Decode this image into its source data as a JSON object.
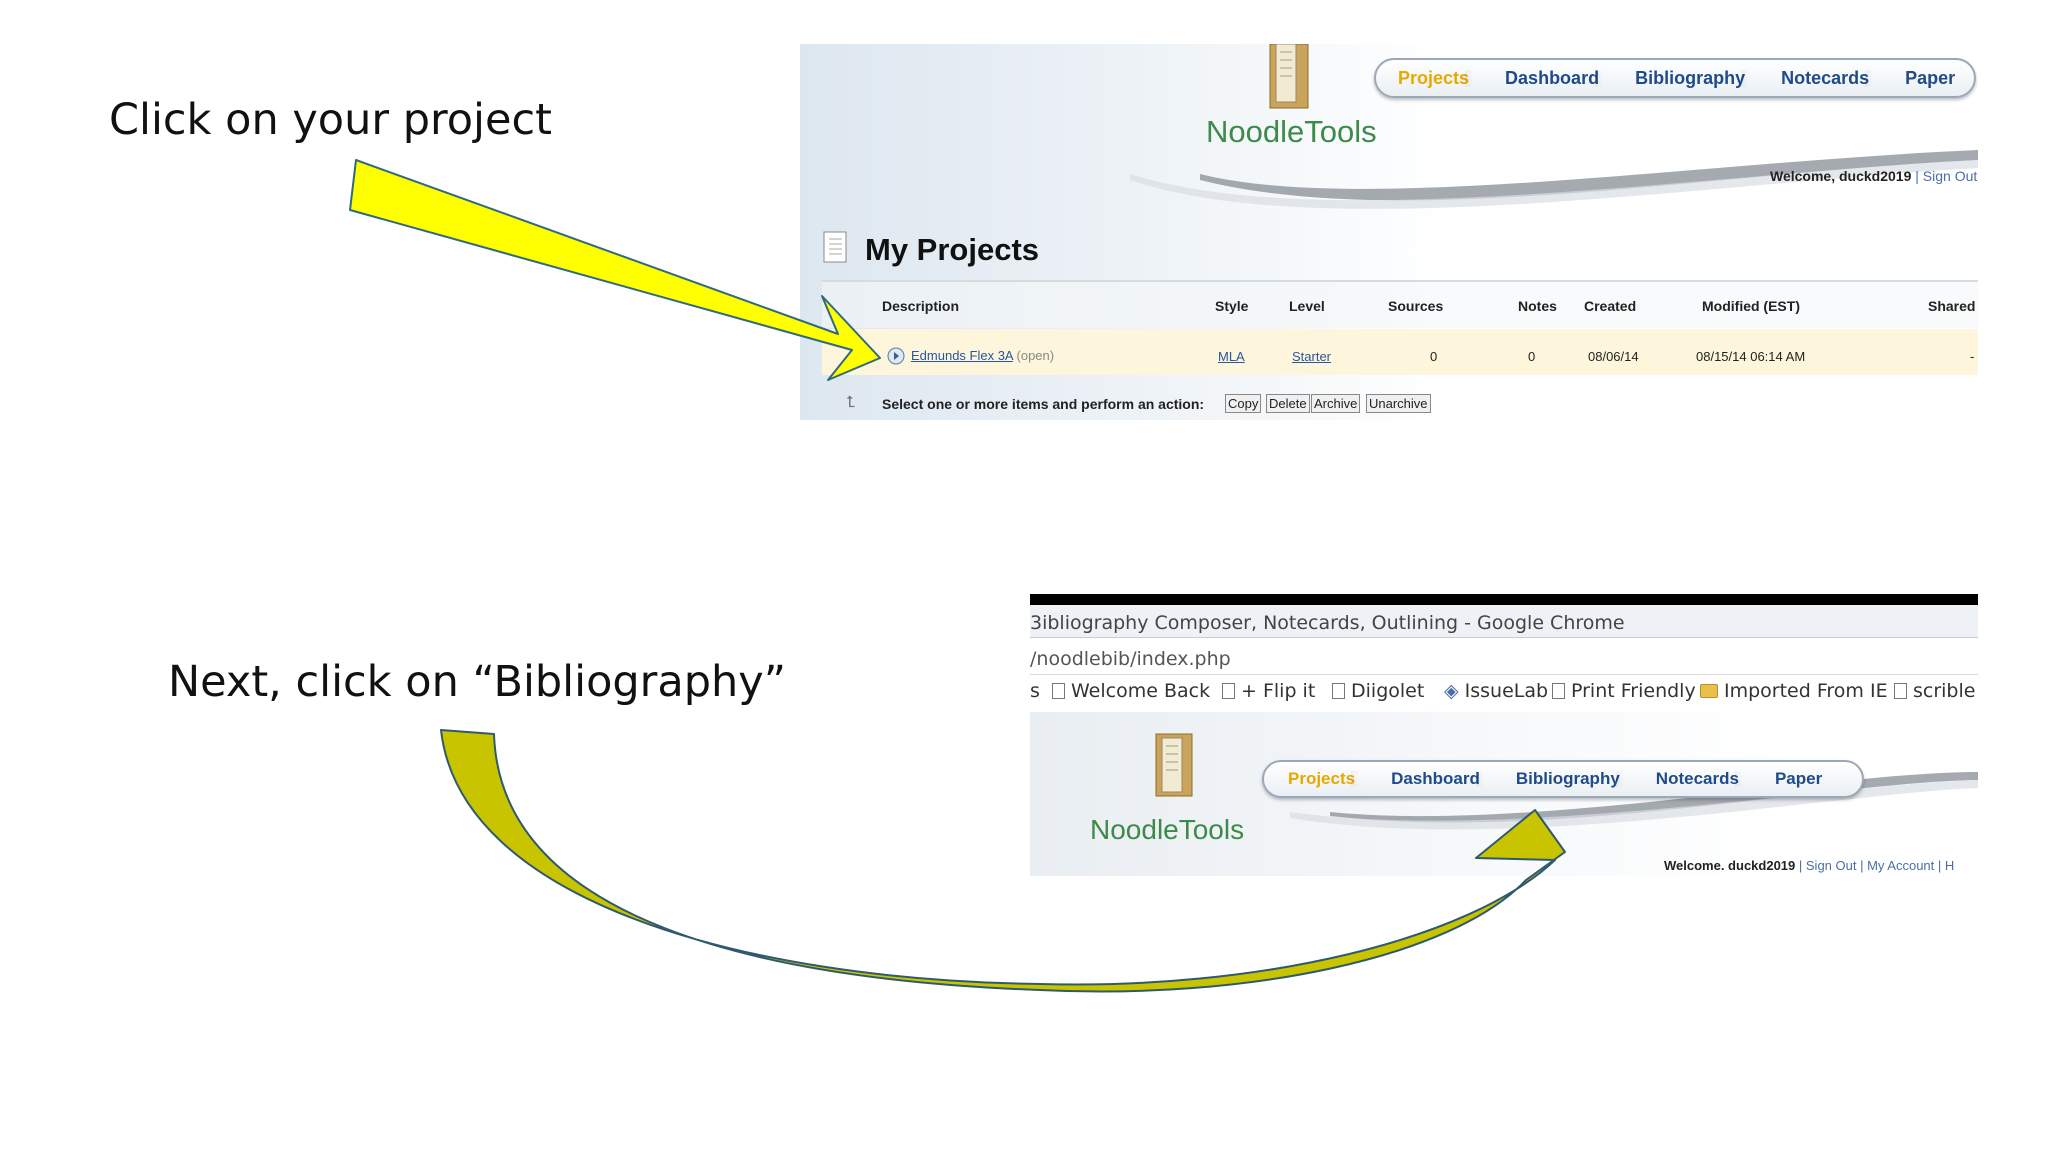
{
  "instructions": {
    "step1": "Click on your project",
    "step2": "Next, click on “Bibliography”"
  },
  "shot1": {
    "logo": "NoodleTools",
    "nav": [
      {
        "label": "Projects",
        "active": true
      },
      {
        "label": "Dashboard",
        "active": false
      },
      {
        "label": "Bibliography",
        "active": false
      },
      {
        "label": "Notecards",
        "active": false
      },
      {
        "label": "Paper",
        "active": false
      }
    ],
    "welcome": "Welcome, duckd2019",
    "sign_out": "| Sign Out",
    "section_title": "My Projects",
    "table": {
      "headers": [
        "Description",
        "Style",
        "Level",
        "Sources",
        "Notes",
        "Created",
        "Modified (EST)",
        "Shared"
      ],
      "row": {
        "description": "Edmunds Flex 3A",
        "status": "(open)",
        "style": "MLA",
        "level": "Starter",
        "sources": "0",
        "notes": "0",
        "created": "08/06/14",
        "modified": "08/15/14 06:14 AM",
        "shared": "-"
      }
    },
    "action_prompt": "Select one or more items and perform an action:",
    "actions": [
      "Copy",
      "Delete",
      "Archive",
      "Unarchive"
    ]
  },
  "shot2": {
    "window_title": "3ibliography Composer, Notecards, Outlining - Google Chrome",
    "url": "/noodlebib/index.php",
    "bookmark_prefix": "s",
    "bookmarks": [
      {
        "label": "Welcome Back",
        "icon": "page-icon"
      },
      {
        "label": "+ Flip it",
        "icon": "page-icon"
      },
      {
        "label": "Diigolet",
        "icon": "page-icon"
      },
      {
        "label": "IssueLab",
        "icon": "issuelab-icon"
      },
      {
        "label": "Print Friendly",
        "icon": "page-icon"
      },
      {
        "label": "Imported From IE",
        "icon": "folder-icon"
      },
      {
        "label": "scrible",
        "icon": "page-icon"
      }
    ],
    "logo": "NoodleTools",
    "nav": [
      {
        "label": "Projects",
        "active": true
      },
      {
        "label": "Dashboard",
        "active": false
      },
      {
        "label": "Bibliography",
        "active": false
      },
      {
        "label": "Notecards",
        "active": false
      },
      {
        "label": "Paper",
        "active": false
      }
    ],
    "welcome": "Welcome. duckd2019",
    "account_links": "| Sign Out | My Account | H"
  },
  "colors": {
    "arrow_bright": "#ffff00",
    "arrow_olive": "#c8c400",
    "nav_text": "#1f4b8a",
    "nav_active": "#e8a800",
    "logo_green": "#3d8a4a",
    "row_highlight": "#fdf6dc"
  }
}
